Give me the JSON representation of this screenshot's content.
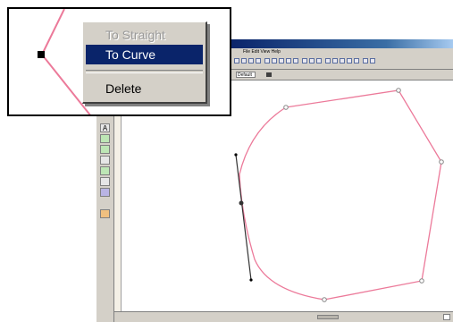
{
  "app": {
    "menu_text": "File   Edit   View   Help",
    "style_select_value": "Default"
  },
  "tools": [
    "A",
    "",
    "",
    "",
    "",
    "",
    "",
    ""
  ],
  "context_menu": {
    "items": [
      {
        "label": "To Straight",
        "state": "disabled"
      },
      {
        "label": "To Curve",
        "state": "selected"
      },
      {
        "label": "Delete",
        "state": "enabled"
      }
    ]
  },
  "colors": {
    "curve": "#ec7a9a",
    "selection": "#0a246a",
    "title_bar": "#0a246a",
    "panel": "#d4d0c8"
  }
}
